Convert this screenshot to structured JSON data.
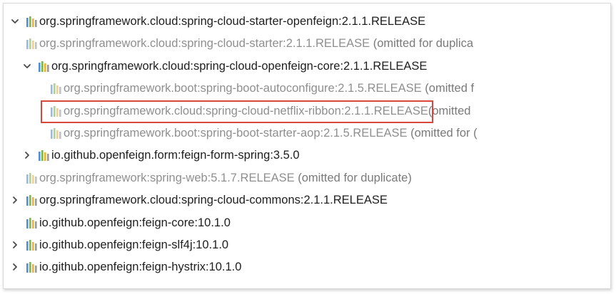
{
  "tree": {
    "rows": [
      {
        "name": "org.springframework.cloud:spring-cloud-starter-openfeign:2.1.1.RELEASE",
        "note": "",
        "muted": false,
        "toggle": "expanded"
      },
      {
        "name": "org.springframework.cloud:spring-cloud-starter:2.1.1.RELEASE",
        "note": " (omitted for duplica",
        "muted": true,
        "toggle": "none"
      },
      {
        "name": "org.springframework.cloud:spring-cloud-openfeign-core:2.1.1.RELEASE",
        "note": "",
        "muted": false,
        "toggle": "expanded"
      },
      {
        "name": "org.springframework.boot:spring-boot-autoconfigure:2.1.5.RELEASE",
        "note": " (omitted f",
        "muted": true,
        "toggle": "none"
      },
      {
        "name": "org.springframework.cloud:spring-cloud-netflix-ribbon:2.1.1.RELEASE",
        "note": "(omitted",
        "muted": true,
        "toggle": "none",
        "highlighted": true
      },
      {
        "name": "org.springframework.boot:spring-boot-starter-aop:2.1.5.RELEASE",
        "note": " (omitted for (",
        "muted": true,
        "toggle": "none"
      },
      {
        "name": "io.github.openfeign.form:feign-form-spring:3.5.0",
        "note": "",
        "muted": false,
        "toggle": "collapsed"
      },
      {
        "name": "org.springframework:spring-web:5.1.7.RELEASE",
        "note": " (omitted for duplicate)",
        "muted": true,
        "toggle": "none"
      },
      {
        "name": "org.springframework.cloud:spring-cloud-commons:2.1.1.RELEASE",
        "note": "",
        "muted": false,
        "toggle": "collapsed"
      },
      {
        "name": "io.github.openfeign:feign-core:10.1.0",
        "note": "",
        "muted": false,
        "toggle": "none"
      },
      {
        "name": "io.github.openfeign:feign-slf4j:10.1.0",
        "note": "",
        "muted": false,
        "toggle": "collapsed"
      },
      {
        "name": "io.github.openfeign:feign-hystrix:10.1.0",
        "note": "",
        "muted": false,
        "toggle": "collapsed"
      }
    ]
  },
  "colors": {
    "highlight_box": "#d9463c",
    "library_icon": [
      "#4f8fd6",
      "#76b947",
      "#f0b233",
      "#9b9b9b"
    ]
  },
  "icons": {
    "expanded": "chevron-down-icon",
    "collapsed": "chevron-right-icon",
    "library": "library-icon"
  }
}
